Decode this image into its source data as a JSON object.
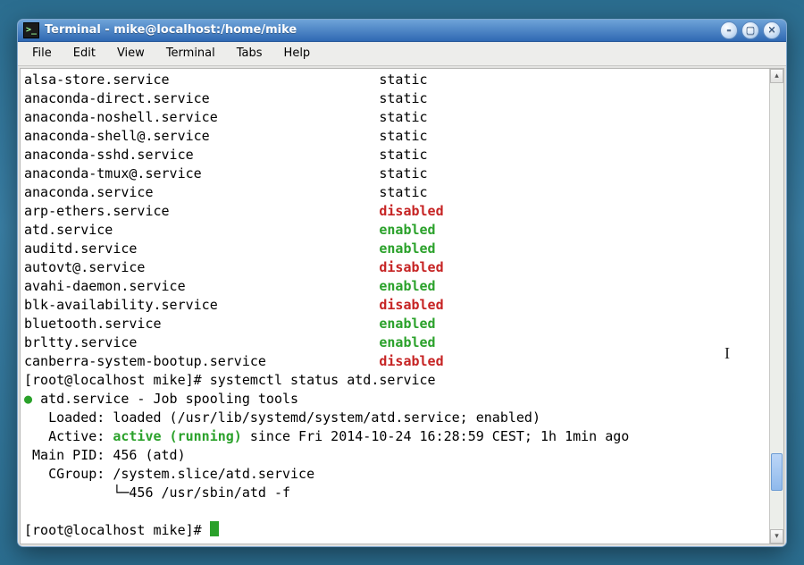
{
  "window": {
    "title": "Terminal - mike@localhost:/home/mike"
  },
  "menubar": [
    "File",
    "Edit",
    "View",
    "Terminal",
    "Tabs",
    "Help"
  ],
  "services": [
    {
      "name": "alsa-store.service",
      "state": "static",
      "cls": ""
    },
    {
      "name": "anaconda-direct.service",
      "state": "static",
      "cls": ""
    },
    {
      "name": "anaconda-noshell.service",
      "state": "static",
      "cls": ""
    },
    {
      "name": "anaconda-shell@.service",
      "state": "static",
      "cls": ""
    },
    {
      "name": "anaconda-sshd.service",
      "state": "static",
      "cls": ""
    },
    {
      "name": "anaconda-tmux@.service",
      "state": "static",
      "cls": ""
    },
    {
      "name": "anaconda.service",
      "state": "static",
      "cls": ""
    },
    {
      "name": "arp-ethers.service",
      "state": "disabled",
      "cls": "red"
    },
    {
      "name": "atd.service",
      "state": "enabled",
      "cls": "green"
    },
    {
      "name": "auditd.service",
      "state": "enabled",
      "cls": "green"
    },
    {
      "name": "autovt@.service",
      "state": "disabled",
      "cls": "red"
    },
    {
      "name": "avahi-daemon.service",
      "state": "enabled",
      "cls": "green"
    },
    {
      "name": "blk-availability.service",
      "state": "disabled",
      "cls": "red"
    },
    {
      "name": "bluetooth.service",
      "state": "enabled",
      "cls": "green"
    },
    {
      "name": "brltty.service",
      "state": "enabled",
      "cls": "green"
    },
    {
      "name": "canberra-system-bootup.service",
      "state": "disabled",
      "cls": "red"
    }
  ],
  "name_col_width": 44,
  "status": {
    "prompt": "[root@localhost mike]# ",
    "cmd": "systemctl status atd.service",
    "unit_line": "atd.service - Job spooling tools",
    "loaded": "   Loaded: loaded (/usr/lib/systemd/system/atd.service; enabled)",
    "active_prefix": "   Active: ",
    "active_state": "active (running)",
    "active_suffix": " since Fri 2014-10-24 16:28:59 CEST; 1h 1min ago",
    "main_pid": " Main PID: 456 (atd)",
    "cgroup1": "   CGroup: /system.slice/atd.service",
    "cgroup2": "           └─456 /usr/sbin/atd -f"
  },
  "icons": {
    "minimize": "–",
    "maximize": "▢",
    "close": "✕",
    "scroll_up": "▴",
    "scroll_down": "▾",
    "app": ">_"
  }
}
